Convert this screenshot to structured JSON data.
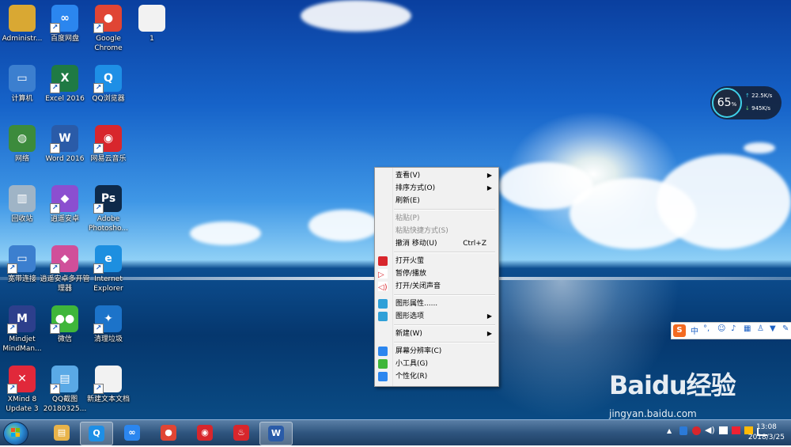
{
  "desktop_icons": [
    {
      "label": "Administr...",
      "icon": "user-folder-icon",
      "color": "#d9a833",
      "glyph": ""
    },
    {
      "label": "百度网盘",
      "icon": "baidu-netdisk-icon",
      "color": "#2b86ef",
      "glyph": "∞"
    },
    {
      "label": "Google Chrome",
      "icon": "chrome-icon",
      "color": "#e04534",
      "glyph": "●"
    },
    {
      "label": "1",
      "icon": "text-file-icon",
      "color": "#f2f2f2",
      "glyph": ""
    },
    {
      "label": "计算机",
      "icon": "computer-icon",
      "color": "#3c7fcf",
      "glyph": "▭"
    },
    {
      "label": "Excel 2016",
      "icon": "excel-icon",
      "color": "#1f7a44",
      "glyph": "X"
    },
    {
      "label": "QQ浏览器",
      "icon": "qq-browser-icon",
      "color": "#1e8fe6",
      "glyph": "Q"
    },
    {
      "label": "网络",
      "icon": "network-icon",
      "color": "#3c8b3c",
      "glyph": "◍"
    },
    {
      "label": "Word 2016",
      "icon": "word-icon",
      "color": "#2a5ba8",
      "glyph": "W"
    },
    {
      "label": "网易云音乐",
      "icon": "netease-music-icon",
      "color": "#d8262c",
      "glyph": "◉"
    },
    {
      "label": "回收站",
      "icon": "recycle-bin-icon",
      "color": "#9fb4c6",
      "glyph": "▥"
    },
    {
      "label": "逍遥安卓",
      "icon": "xiaoyao-android-icon",
      "color": "#8b4fd0",
      "glyph": "◆"
    },
    {
      "label": "Adobe Photosho...",
      "icon": "photoshop-icon",
      "color": "#0e2a4a",
      "glyph": "Ps"
    },
    {
      "label": "宽带连接",
      "icon": "broadband-icon",
      "color": "#3c7fcf",
      "glyph": "▭"
    },
    {
      "label": "逍遥安卓多开管理器",
      "icon": "xiaoyao-multi-icon",
      "color": "#d04f9a",
      "glyph": "◆"
    },
    {
      "label": "Internet Explorer",
      "icon": "ie-icon",
      "color": "#1d8fe0",
      "glyph": "e"
    },
    {
      "label": "Mindjet MindMan...",
      "icon": "mindjet-icon",
      "color": "#2d3f8c",
      "glyph": "M"
    },
    {
      "label": "微信",
      "icon": "wechat-icon",
      "color": "#3fb63a",
      "glyph": "●●"
    },
    {
      "label": "清理垃圾",
      "icon": "cleanup-icon",
      "color": "#1c73c9",
      "glyph": "✦"
    },
    {
      "label": "XMind 8 Update 3",
      "icon": "xmind-icon",
      "color": "#e1283a",
      "glyph": "✕"
    },
    {
      "label": "QQ截图20180325...",
      "icon": "screenshot-image-icon",
      "color": "#5aa9e6",
      "glyph": "▤"
    },
    {
      "label": "新建文本文档",
      "icon": "text-document-icon",
      "color": "#f2f2f2",
      "glyph": ""
    }
  ],
  "context_menu": {
    "items": [
      {
        "label": "查看(V)",
        "submenu": true
      },
      {
        "label": "排序方式(O)",
        "submenu": true
      },
      {
        "label": "刷新(E)"
      },
      {
        "label": "粘贴(P)",
        "disabled": true
      },
      {
        "label": "粘贴快捷方式(S)",
        "disabled": true
      },
      {
        "label": "撤消 移动(U)",
        "shortcut": "Ctrl+Z"
      },
      {
        "label": "打开火萤",
        "icon": "huoying-icon"
      },
      {
        "label": "暂停/播放",
        "icon": "play-icon"
      },
      {
        "label": "打开/关闭声音",
        "icon": "speaker-icon"
      },
      {
        "label": "图形属性......",
        "icon": "graphics-props-icon"
      },
      {
        "label": "图形选项",
        "icon": "graphics-options-icon",
        "submenu": true
      },
      {
        "label": "新建(W)",
        "submenu": true
      },
      {
        "label": "屏幕分辨率(C)",
        "icon": "resolution-icon"
      },
      {
        "label": "小工具(G)",
        "icon": "gadgets-icon"
      },
      {
        "label": "个性化(R)",
        "icon": "personalize-icon"
      }
    ]
  },
  "net_widget": {
    "percent": "65",
    "unit": "%",
    "upload": "22.5K/s",
    "download": "945K/s"
  },
  "ime_bar": {
    "logo": "S",
    "mode": "中"
  },
  "watermark": {
    "brand": "Baidu经验",
    "url": "jingyan.baidu.com"
  },
  "taskbar": {
    "items": [
      {
        "icon": "file-explorer-icon",
        "color": "#e8b34a",
        "active": false
      },
      {
        "icon": "qq-browser-icon",
        "color": "#1e8fe6",
        "active": true
      },
      {
        "icon": "baidu-netdisk-icon",
        "color": "#2b86ef",
        "active": false
      },
      {
        "icon": "chrome-icon",
        "color": "#e04534",
        "active": false
      },
      {
        "icon": "netease-music-icon",
        "color": "#d8262c",
        "active": false
      },
      {
        "icon": "huoying-icon",
        "color": "#d8262c",
        "active": false
      },
      {
        "icon": "word-icon",
        "color": "#2a5ba8",
        "active": true
      }
    ],
    "time": "13:08",
    "date": "2018/3/25"
  }
}
